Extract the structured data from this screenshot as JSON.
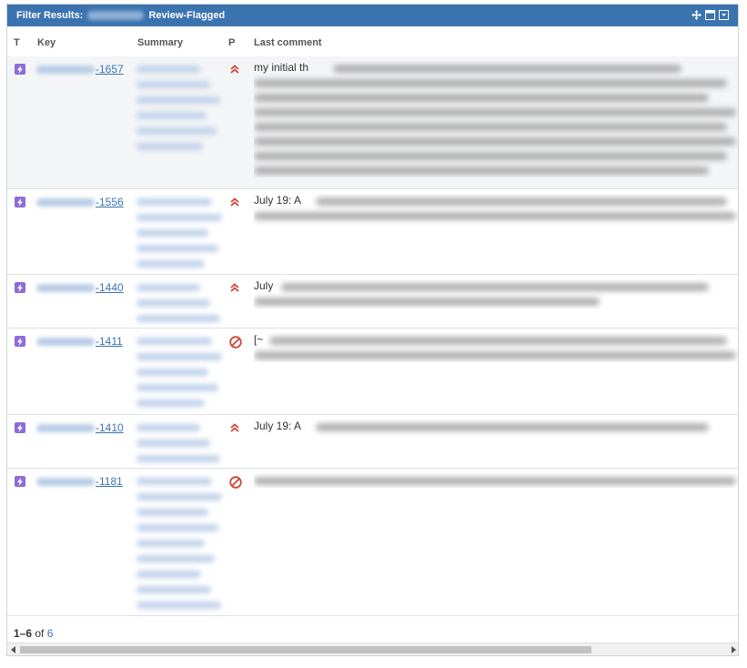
{
  "gadget": {
    "title_prefix": "Filter Results:",
    "title_suffix": "Review-Flagged",
    "controls": [
      "move-icon",
      "maximize-icon",
      "menu-icon"
    ]
  },
  "table": {
    "headers": [
      "T",
      "Key",
      "Summary",
      "P",
      "Last comment"
    ],
    "rows": [
      {
        "key": "-1657",
        "priority": "high",
        "comment_lines": [
          "my initial th",
          "",
          "",
          "",
          "",
          "",
          "",
          ""
        ]
      },
      {
        "key": "-1556",
        "priority": "high",
        "comment_lines": [
          "July 19: A",
          "",
          "",
          ""
        ]
      },
      {
        "key": "-1440",
        "priority": "high",
        "comment_lines": [
          "July",
          ""
        ]
      },
      {
        "key": "-1411",
        "priority": "blocked",
        "comment_lines": [
          "[~",
          ""
        ]
      },
      {
        "key": "-1410",
        "priority": "high",
        "comment_lines": [
          "July 19: A",
          ""
        ]
      },
      {
        "key": "-1181",
        "priority": "blocked",
        "comment_lines": [
          ""
        ]
      }
    ]
  },
  "footer": {
    "range": "1–6",
    "of_label": "of",
    "total": "6"
  },
  "colors": {
    "titlebar": "#3b73af",
    "link": "#3b73af",
    "type_icon": "#8e6bd8",
    "priority_high": "#d04437",
    "priority_blocked": "#d04437"
  }
}
